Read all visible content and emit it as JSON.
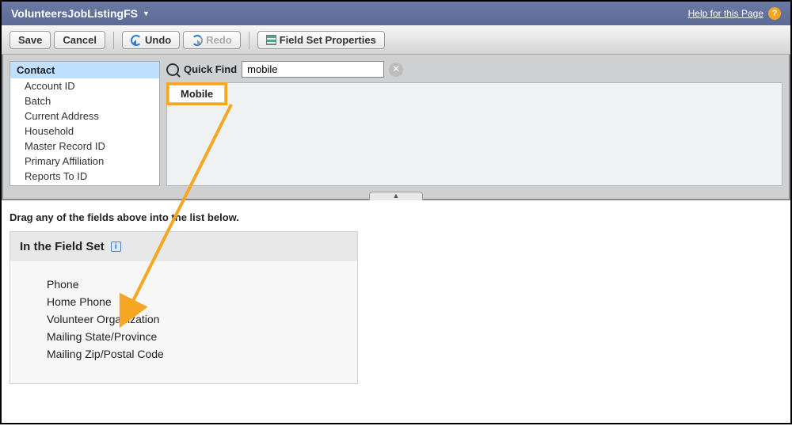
{
  "header": {
    "title": "VolunteersJobListingFS",
    "help_label": "Help for this Page"
  },
  "toolbar": {
    "save": "Save",
    "cancel": "Cancel",
    "undo": "Undo",
    "redo": "Redo",
    "properties": "Field Set Properties"
  },
  "palette": {
    "active_category": "Contact",
    "categories": [
      "Account ID",
      "Batch",
      "Current Address",
      "Household",
      "Master Record ID",
      "Primary Affiliation",
      "Reports To ID"
    ],
    "quick_find_label": "Quick Find",
    "quick_find_value": "mobile",
    "results": [
      "Mobile"
    ]
  },
  "instruction": "Drag any of the fields above into the list below.",
  "fieldset": {
    "title": "In the Field Set",
    "fields": [
      "Phone",
      "Home Phone",
      "Volunteer Organization",
      "Mailing State/Province",
      "Mailing Zip/Postal Code"
    ]
  }
}
